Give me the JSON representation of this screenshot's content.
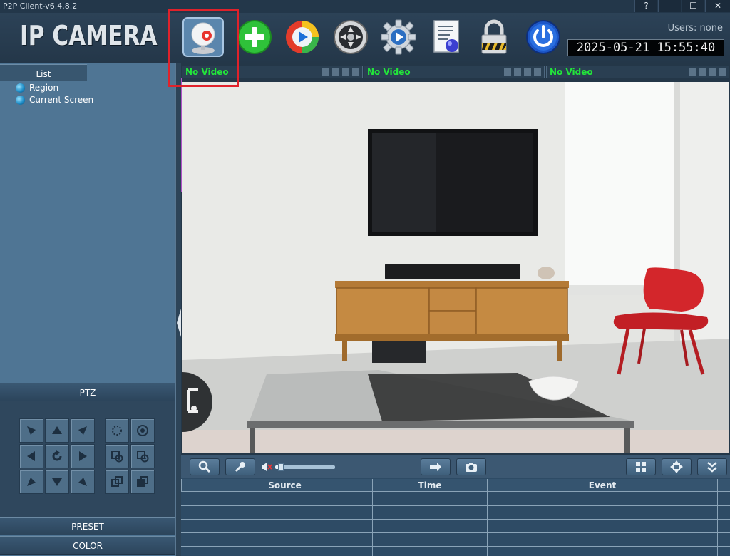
{
  "window": {
    "title": "P2P Client-v6.4.8.2",
    "controls": [
      "?",
      "–",
      "☐",
      "✕"
    ]
  },
  "toolbar": {
    "logo": "IP CAMERA",
    "users_label": "Users: none",
    "datetime": "2025-05-21  15:55:40",
    "buttons": [
      "camera-view",
      "add-device",
      "playback",
      "ptz-wheel",
      "settings",
      "log",
      "lock",
      "power"
    ]
  },
  "left_panel": {
    "list_tab": "List",
    "tree": [
      "Region",
      "Current Screen"
    ],
    "ptz_label": "PTZ",
    "preset_label": "PRESET",
    "color_label": "COLOR"
  },
  "video": {
    "panes": [
      {
        "status": "No Video"
      },
      {
        "status": "No Video"
      },
      {
        "status": "No Video"
      }
    ],
    "volume_level": 0.1
  },
  "events": {
    "columns": [
      "Source",
      "Time",
      "Event"
    ]
  },
  "colors": {
    "no_video_text": "#22e63a",
    "highlight_box": "#e0222b",
    "accent_blue": "#1c6fd8"
  }
}
